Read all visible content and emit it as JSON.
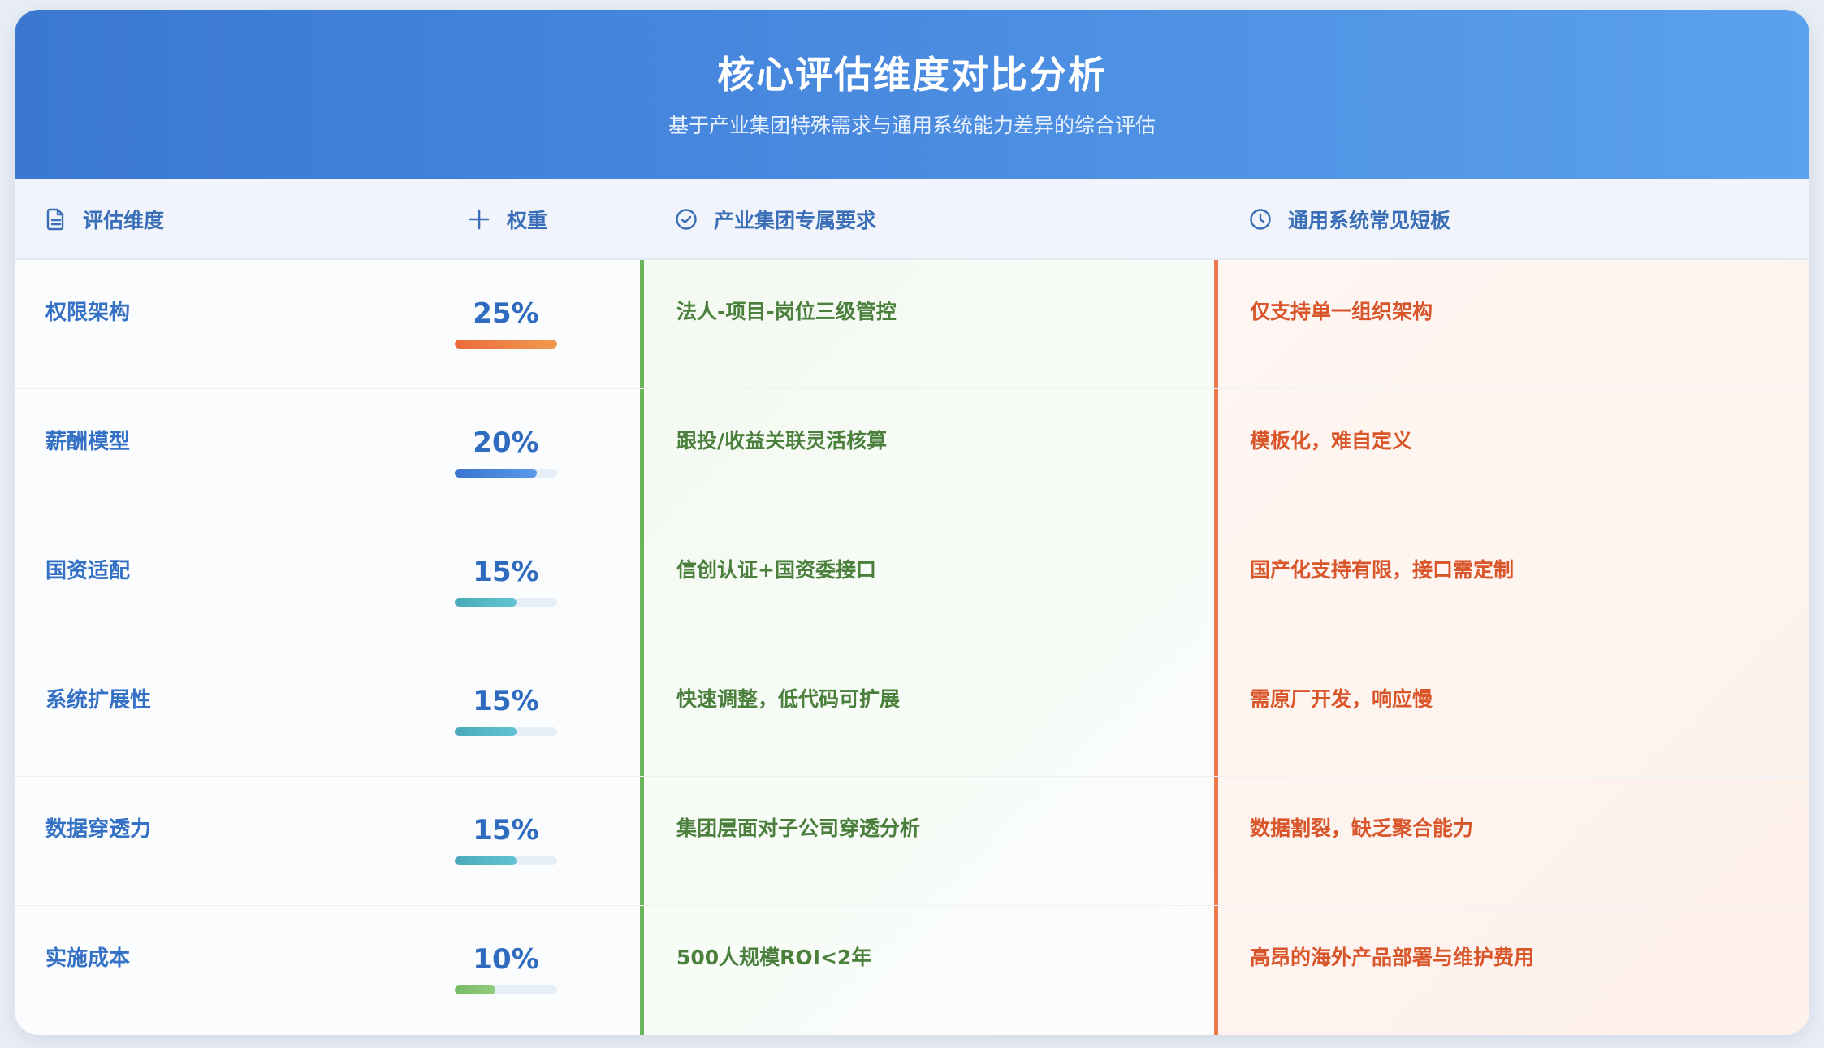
{
  "header": {
    "title": "核心评估维度对比分析",
    "subtitle": "基于产业集团特殊需求与通用系统能力差异的综合评估"
  },
  "columns": {
    "dimension": "评估维度",
    "weight": "权重",
    "requirement": "产业集团专属要求",
    "gap": "通用系统常见短板"
  },
  "icons": {
    "dimension": "document-icon",
    "weight": "sparkle-icon",
    "requirement": "check-circle-icon",
    "gap": "clock-icon"
  },
  "colors": {
    "accent_blue": "#3470c4",
    "requirement_green": "#4a7f3c",
    "gap_red": "#d9552a"
  },
  "rows": [
    {
      "dimension": "权限架构",
      "weight": "25%",
      "weight_value": 1.0,
      "bar_color": "linear-gradient(90deg,#ec6b3c,#f09a4e)",
      "requirement": "法人-项目-岗位三级管控",
      "gap": "仅支持单一组织架构"
    },
    {
      "dimension": "薪酬模型",
      "weight": "20%",
      "weight_value": 0.8,
      "bar_color": "linear-gradient(90deg,#3a74d0,#5a9ae8)",
      "requirement": "跟投/收益关联灵活核算",
      "gap": "模板化，难自定义"
    },
    {
      "dimension": "国资适配",
      "weight": "15%",
      "weight_value": 0.6,
      "bar_color": "linear-gradient(90deg,#4aaab8,#62c4d2)",
      "requirement": "信创认证+国资委接口",
      "gap": "国产化支持有限，接口需定制"
    },
    {
      "dimension": "系统扩展性",
      "weight": "15%",
      "weight_value": 0.6,
      "bar_color": "linear-gradient(90deg,#4aaab8,#62c4d2)",
      "requirement": "快速调整，低代码可扩展",
      "gap": "需原厂开发，响应慢"
    },
    {
      "dimension": "数据穿透力",
      "weight": "15%",
      "weight_value": 0.6,
      "bar_color": "linear-gradient(90deg,#4aaab8,#62c4d2)",
      "requirement": "集团层面对子公司穿透分析",
      "gap": "数据割裂，缺乏聚合能力"
    },
    {
      "dimension": "实施成本",
      "weight": "10%",
      "weight_value": 0.4,
      "bar_color": "linear-gradient(90deg,#78bb68,#92cc7e)",
      "requirement": "500人规模ROI<2年",
      "gap": "高昂的海外产品部署与维护费用"
    }
  ]
}
